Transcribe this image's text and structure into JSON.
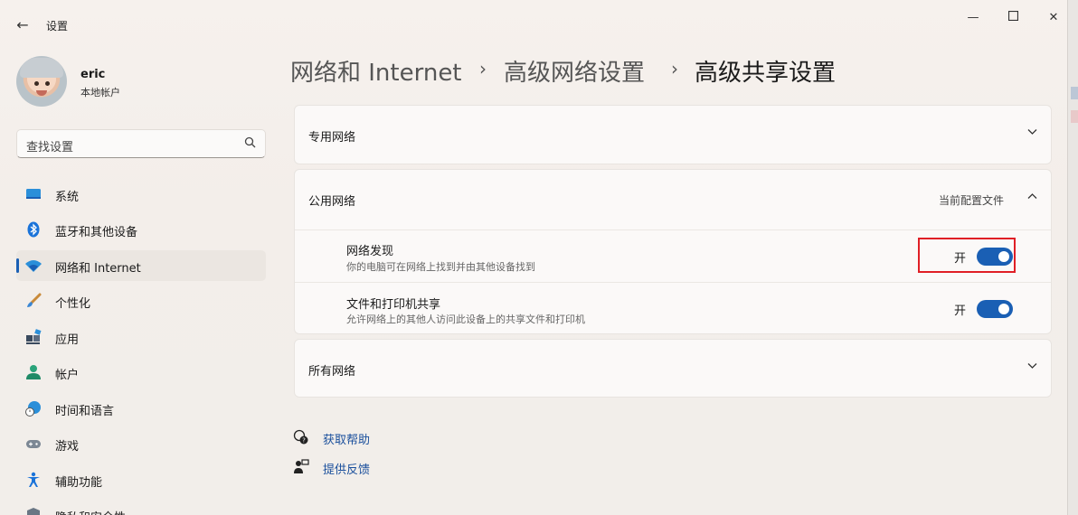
{
  "window": {
    "title": "设置"
  },
  "profile": {
    "name": "eric",
    "account_type": "本地帐户"
  },
  "search": {
    "placeholder": "查找设置"
  },
  "sidebar": {
    "items": [
      {
        "label": "系统",
        "icon": "system-icon"
      },
      {
        "label": "蓝牙和其他设备",
        "icon": "bluetooth-icon"
      },
      {
        "label": "网络和 Internet",
        "icon": "wifi-icon",
        "active": true
      },
      {
        "label": "个性化",
        "icon": "brush-icon"
      },
      {
        "label": "应用",
        "icon": "apps-icon"
      },
      {
        "label": "帐户",
        "icon": "account-icon"
      },
      {
        "label": "时间和语言",
        "icon": "globe-clock-icon"
      },
      {
        "label": "游戏",
        "icon": "gamepad-icon"
      },
      {
        "label": "辅助功能",
        "icon": "accessibility-icon"
      },
      {
        "label": "隐私和安全性",
        "icon": "shield-icon"
      }
    ]
  },
  "breadcrumb": {
    "items": [
      "网络和 Internet",
      "高级网络设置",
      "高级共享设置"
    ],
    "separator": "›"
  },
  "sections": {
    "private": {
      "title": "专用网络"
    },
    "public": {
      "title": "公用网络",
      "profile_label": "当前配置文件",
      "settings": [
        {
          "title": "网络发现",
          "description": "你的电脑可在网络上找到并由其他设备找到",
          "state_label": "开",
          "on": true
        },
        {
          "title": "文件和打印机共享",
          "description": "允许网络上的其他人访问此设备上的共享文件和打印机",
          "state_label": "开",
          "on": true
        }
      ]
    },
    "all": {
      "title": "所有网络"
    }
  },
  "help": {
    "get_help": "获取帮助",
    "feedback": "提供反馈"
  },
  "colors": {
    "accent": "#1a5fb4",
    "highlight": "#e01f26",
    "link": "#1a4f9c"
  }
}
